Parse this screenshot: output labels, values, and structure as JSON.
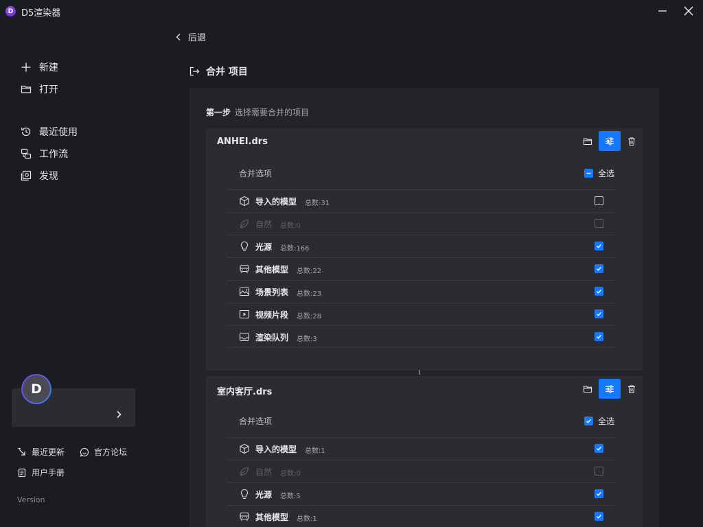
{
  "app": {
    "title": "D5渲染器",
    "logo_letter": "D"
  },
  "sidebar": {
    "items": [
      {
        "label": "新建",
        "icon": "plus-icon"
      },
      {
        "label": "打开",
        "icon": "folder-icon"
      },
      {
        "label": "最近使用",
        "icon": "history-icon"
      },
      {
        "label": "工作流",
        "icon": "workflow-icon"
      },
      {
        "label": "发现",
        "icon": "discover-icon"
      }
    ],
    "avatar_letter": "D",
    "footer": {
      "updates": "最近更新",
      "forum": "官方论坛",
      "manual": "用户手册",
      "version": "Version"
    }
  },
  "main": {
    "back_label": "后退",
    "title": "合并 项目",
    "step_label": "第一步",
    "step_desc": "选择需要合并的项目",
    "cards": [
      {
        "name": "ANHEI.drs",
        "options_label": "合并选项",
        "select_all_label": "全选",
        "select_all_state": "partial",
        "rows": [
          {
            "label": "导入的模型",
            "count": "总数:31",
            "checked": false,
            "disabled": false,
            "icon": "cube-icon"
          },
          {
            "label": "自然",
            "count": "总数:0",
            "checked": false,
            "disabled": true,
            "icon": "leaf-icon"
          },
          {
            "label": "光源",
            "count": "总数:166",
            "checked": true,
            "disabled": false,
            "icon": "bulb-icon"
          },
          {
            "label": "其他模型",
            "count": "总数:22",
            "checked": true,
            "disabled": false,
            "icon": "vehicle-icon"
          },
          {
            "label": "场景列表",
            "count": "总数:23",
            "checked": true,
            "disabled": false,
            "icon": "image-icon"
          },
          {
            "label": "视频片段",
            "count": "总数:28",
            "checked": true,
            "disabled": false,
            "icon": "video-icon"
          },
          {
            "label": "渲染队列",
            "count": "总数:3",
            "checked": true,
            "disabled": false,
            "icon": "tray-icon"
          }
        ]
      },
      {
        "name": "室内客厅.drs",
        "options_label": "合并选项",
        "select_all_label": "全选",
        "select_all_state": "checked",
        "rows": [
          {
            "label": "导入的模型",
            "count": "总数:1",
            "checked": true,
            "disabled": false,
            "icon": "cube-icon"
          },
          {
            "label": "自然",
            "count": "总数:0",
            "checked": false,
            "disabled": true,
            "icon": "leaf-icon"
          },
          {
            "label": "光源",
            "count": "总数:5",
            "checked": true,
            "disabled": false,
            "icon": "bulb-icon"
          },
          {
            "label": "其他模型",
            "count": "总数:1",
            "checked": true,
            "disabled": false,
            "icon": "vehicle-icon"
          }
        ]
      }
    ]
  },
  "colors": {
    "accent": "#1677ff",
    "bg": "#1b1c21",
    "panel": "#23242a",
    "card": "#2b2c32"
  }
}
